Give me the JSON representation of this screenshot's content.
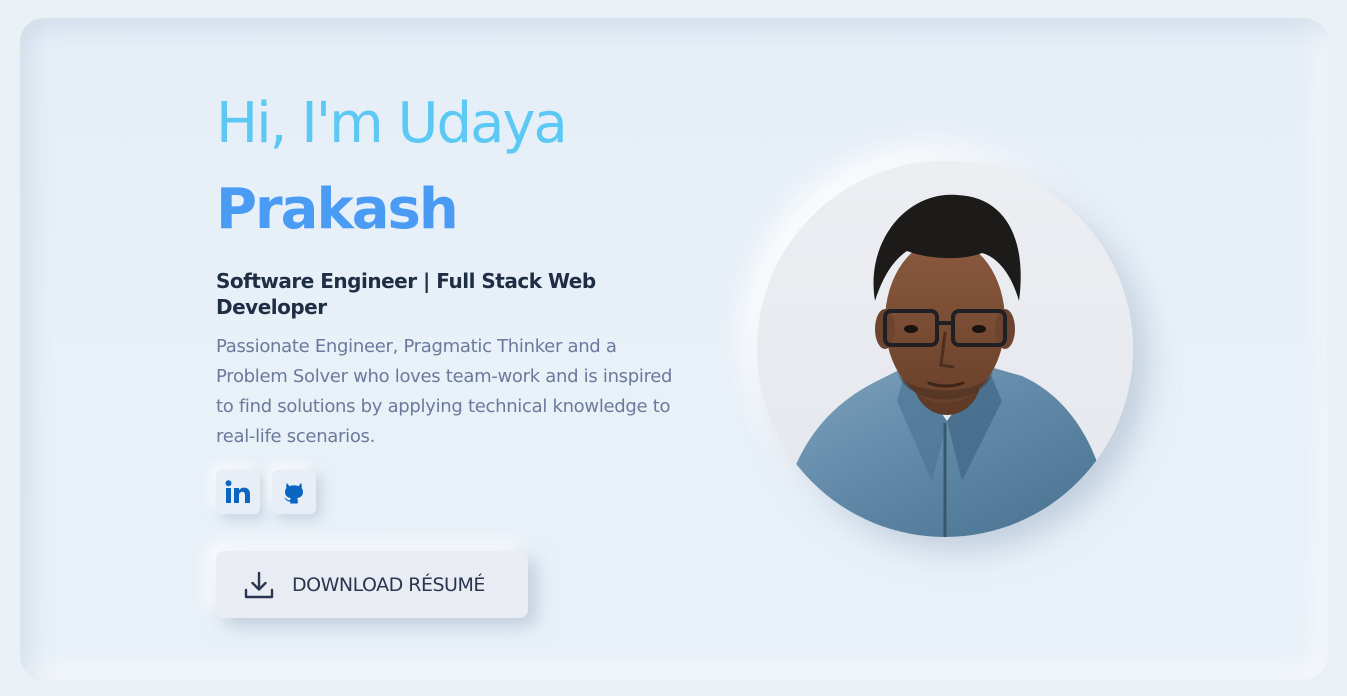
{
  "hero": {
    "greeting": "Hi, I'm Udaya",
    "lastname": "Prakash",
    "role": "Software Engineer | Full Stack Web Developer",
    "bio": "Passionate Engineer, Pragmatic Thinker and a Problem Solver who loves team-work and is inspired to find solutions by applying technical knowledge to real-life scenarios."
  },
  "socials": [
    {
      "name": "linkedin",
      "icon": "linkedin-icon"
    },
    {
      "name": "github",
      "icon": "github-icon"
    }
  ],
  "resume_button": {
    "label": "DOWNLOAD RÉSUMÉ",
    "icon": "download-icon"
  },
  "colors": {
    "greeting": "#5cc9f5",
    "lastname": "#4a9bf3",
    "role": "#1f2d45",
    "bio": "#6b7a9c",
    "icon_blue": "#0a66c2",
    "background": "#e9f1f7"
  }
}
